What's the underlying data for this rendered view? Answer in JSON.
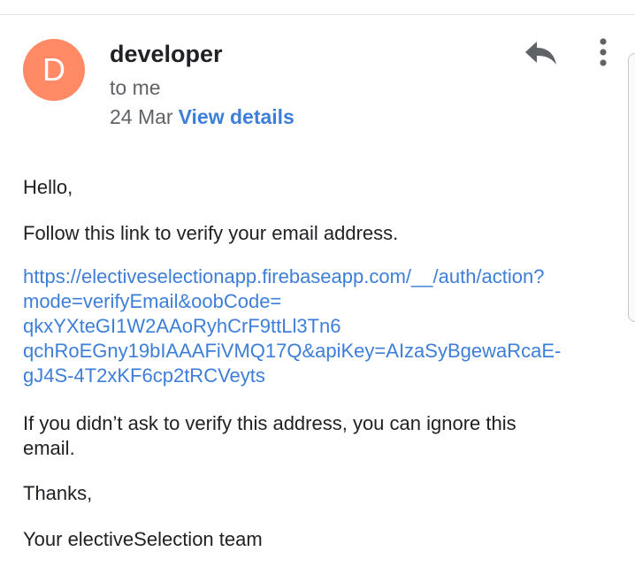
{
  "header": {
    "avatar_letter": "D",
    "avatar_color": "#ff8a65",
    "sender": "developer",
    "recipient": "to me",
    "date": "24 Mar",
    "view_details": "View details",
    "reply_icon": "reply-icon",
    "more_icon": "more-vert-icon"
  },
  "body": {
    "greeting": "Hello,",
    "instruction": "Follow this link to verify your email address.",
    "link_lines": [
      "https://electiveselectionapp.firebaseapp.com/__/auth/action?",
      "mode=verifyEmail&oobCode=",
      "qkxYXteGI1W2AAoRyhCrF9ttLl3Tn6",
      "qchRoEGny19bIAAAFiVMQ17Q&apiKey=AIzaSyBgewaRcaE-",
      "gJ4S-4T2xKF6cp2tRCVeyts"
    ],
    "ignore_lines": [
      "If you didn’t ask to verify this address, you can ignore this",
      "email."
    ],
    "thanks": "Thanks,",
    "signature": "Your electiveSelection team"
  },
  "colors": {
    "link": "#3d7fd8",
    "secondary_text": "#5f6368",
    "primary_text": "#202124"
  }
}
